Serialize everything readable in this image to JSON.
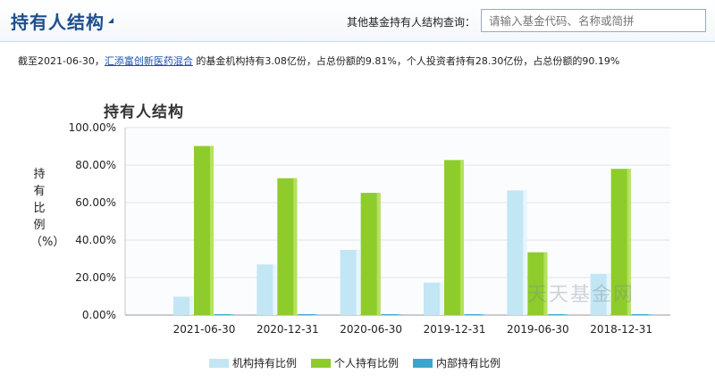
{
  "header": {
    "title": "持有人结构",
    "search_label": "其他基金持有人结构查询：",
    "search_placeholder": "请输入基金代码、名称或简拼"
  },
  "summary": {
    "prefix": "截至2021-06-30，",
    "fund_link": "汇添富创新医药混合",
    "suffix": " 的基金机构持有3.08亿份，占总份额的9.81%，个人投资者持有28.30亿份，占总份额的90.19%"
  },
  "watermark": "天天基金网",
  "colors": {
    "institution": "#c3e6f5",
    "individual": "#8ecc2b",
    "internal": "#3aa6cf",
    "grid": "#e3e3e3",
    "title": "#1d4f8c"
  },
  "chart_data": {
    "type": "bar",
    "title": "持有人结构",
    "ylabel": "持有比例（%）",
    "xlabel": "",
    "categories": [
      "2021-06-30",
      "2020-12-31",
      "2020-06-30",
      "2019-12-31",
      "2019-06-30",
      "2018-12-31"
    ],
    "ylim": [
      0,
      100
    ],
    "yticks": [
      "0.00%",
      "20.00%",
      "40.00%",
      "60.00%",
      "80.00%",
      "100.00%"
    ],
    "grid": true,
    "legend_position": "bottom",
    "series": [
      {
        "name": "机构持有比例",
        "values": [
          9.81,
          27.0,
          34.8,
          17.3,
          66.5,
          22.0
        ]
      },
      {
        "name": "个人持有比例",
        "values": [
          90.19,
          73.0,
          65.2,
          82.7,
          33.5,
          78.0
        ]
      },
      {
        "name": "内部持有比例",
        "values": [
          0.2,
          0.2,
          0.2,
          0.2,
          0.2,
          0.2
        ]
      }
    ]
  }
}
